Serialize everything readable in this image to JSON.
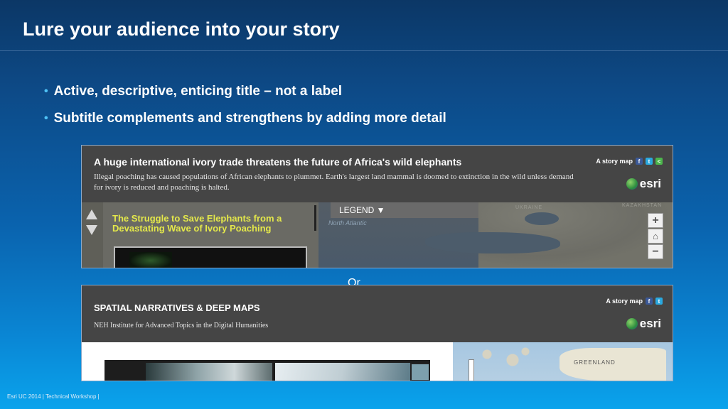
{
  "slide": {
    "title": "Lure your audience into your story",
    "bullets": [
      "Active, descriptive, enticing title – not a label",
      "Subtitle complements and strengthens by adding more detail"
    ],
    "separator": "Or",
    "footer": "Esri UC 2014 | Technical Workshop |"
  },
  "example1": {
    "title": "A huge international ivory trade threatens the future of Africa's wild elephants",
    "subtitle": "Illegal poaching has caused populations of African elephants to plummet. Earth's largest land mammal is doomed to extinction in the wild unless demand for ivory is reduced and poaching is halted.",
    "badge": "A story map",
    "brand": "esri",
    "side_heading": "The Struggle to Save Elephants from a Devastating Wave of Ivory Poaching",
    "legend": "LEGEND ▼",
    "ocean": "North Atlantic",
    "region_labels": [
      "UKRAINE",
      "KAZAKHSTAN"
    ],
    "map_controls": [
      "+",
      "⌂",
      "−"
    ]
  },
  "example2": {
    "title": "SPATIAL NARRATIVES & DEEP MAPS",
    "subtitle": "NEH Institute for Advanced Topics in the Digital Humanities",
    "badge": "A story map",
    "brand": "esri",
    "map_label": "GREENLAND"
  },
  "colors": {
    "header_bar": "#454545",
    "side_heading": "#e4e84a",
    "bullet_dot": "#4fc3f7"
  }
}
